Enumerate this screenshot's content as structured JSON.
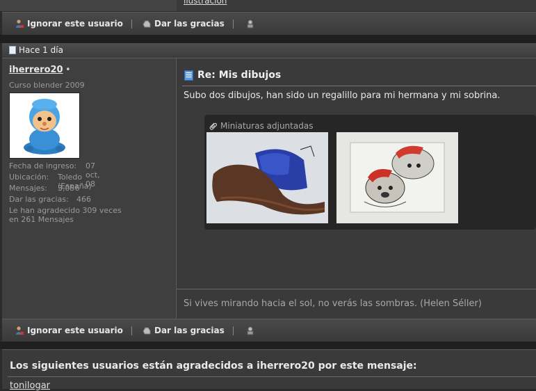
{
  "top_post": {
    "link_text": "ilustración",
    "actions": {
      "ignore": "Ignorar este usuario",
      "thanks": "Dar las gracias"
    }
  },
  "post": {
    "date": "Hace 1 día",
    "user": {
      "name": "iherrero20",
      "status_dot": "•",
      "title": "Curso blender 2009",
      "info": [
        {
          "label": "Fecha de ingreso:",
          "value": "07 oct, 08"
        },
        {
          "label": "Ubicación:",
          "value": "Toledo (España)"
        },
        {
          "label": "Mensajes:",
          "value": "3,056"
        },
        {
          "label": "Dar las gracias:",
          "value": "466"
        }
      ],
      "thanked_line1": "Le han agradecido 309 veces",
      "thanked_line2": "en 261 Mensajes"
    },
    "title": "Re: Mis dibujos",
    "body": "Subo dos dibujos, han sido un regalillo para mi hermana y mi sobrina.",
    "attachments_label": "Miniaturas adjuntadas",
    "signature": "Si vives mirando hacia el sol, no verás las sombras. (Helen Séller)",
    "actions": {
      "ignore": "Ignorar este usuario",
      "thanks": "Dar las gracias"
    }
  },
  "thanks_box": {
    "title": "Los siguientes usuarios están agradecidos a iherrero20 por este mensaje:",
    "users": [
      "tonilogar"
    ]
  },
  "colors": {
    "background": "#2b2b2b",
    "panel": "#3a3a3a",
    "userpanel": "#3f3f3f",
    "attachment_bg": "#262626"
  }
}
